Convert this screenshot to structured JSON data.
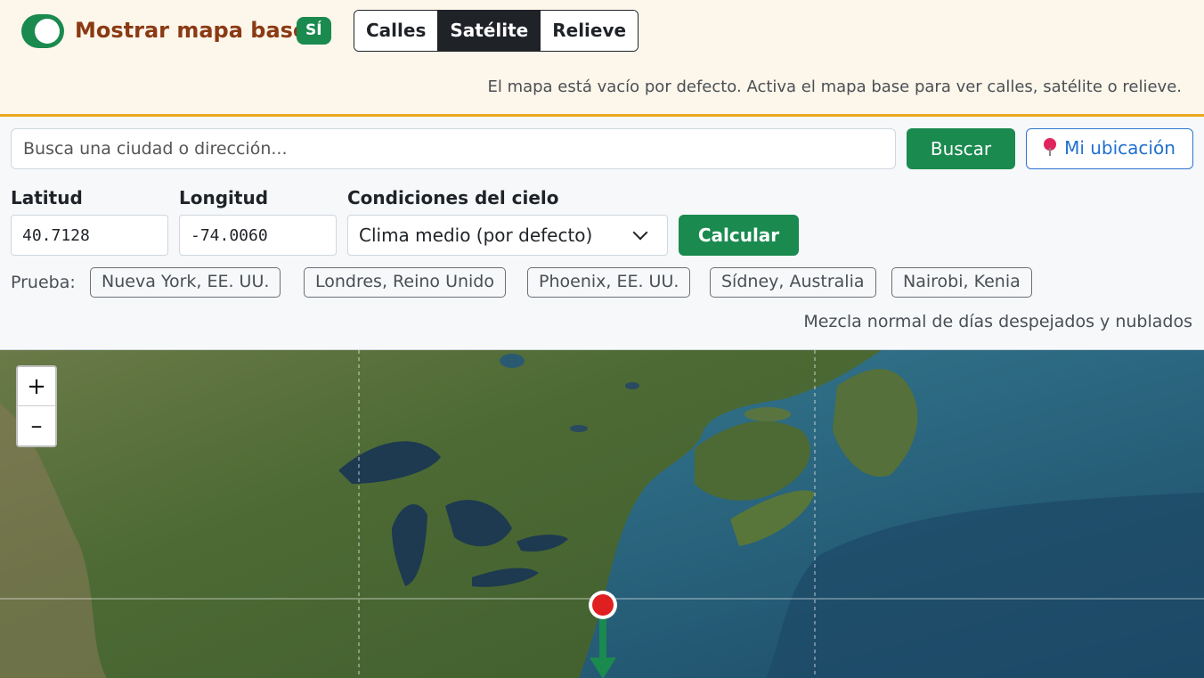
{
  "banner": {
    "toggle_label": "Mostrar mapa base",
    "toggle_state": "SÍ",
    "toggle_on": true,
    "layers": [
      {
        "label": "Calles",
        "active": false
      },
      {
        "label": "Satélite",
        "active": true
      },
      {
        "label": "Relieve",
        "active": false
      }
    ],
    "note": "El mapa está vacío por defecto. Activa el mapa base para ver calles, satélite o relieve."
  },
  "search": {
    "placeholder": "Busca una ciudad o dirección...",
    "value": "",
    "search_label": "Buscar",
    "location_label": "Mi ubicación"
  },
  "form": {
    "lat_label": "Latitud",
    "lat_value": "40.7128",
    "lon_label": "Longitud",
    "lon_value": "-74.0060",
    "sky_label": "Condiciones del cielo",
    "sky_selected": "Clima medio (por defecto)",
    "calc_label": "Calcular"
  },
  "try": {
    "label": "Prueba:",
    "chips": [
      "Nueva York, EE. UU.",
      "Londres, Reino Unido",
      "Phoenix, EE. UU.",
      "Sídney, Australia",
      "Nairobi, Kenia"
    ]
  },
  "condition_note": "Mezcla normal de días despejados y nublados",
  "map": {
    "base_layer": "satellite",
    "zoom_in": "+",
    "zoom_out": "–",
    "marker_color": "#e02020",
    "arrow_color": "#1a8a4f",
    "land_color": "#4f6a3a",
    "ocean_color": "#2f6f86",
    "deep_ocean_color": "#1f4a66"
  },
  "colors": {
    "accent_green": "#1a8a4f",
    "banner_bg": "#fdf6ea",
    "banner_border": "#e8a820",
    "title_brown": "#8a3a14",
    "link_blue": "#1f6fd0"
  }
}
